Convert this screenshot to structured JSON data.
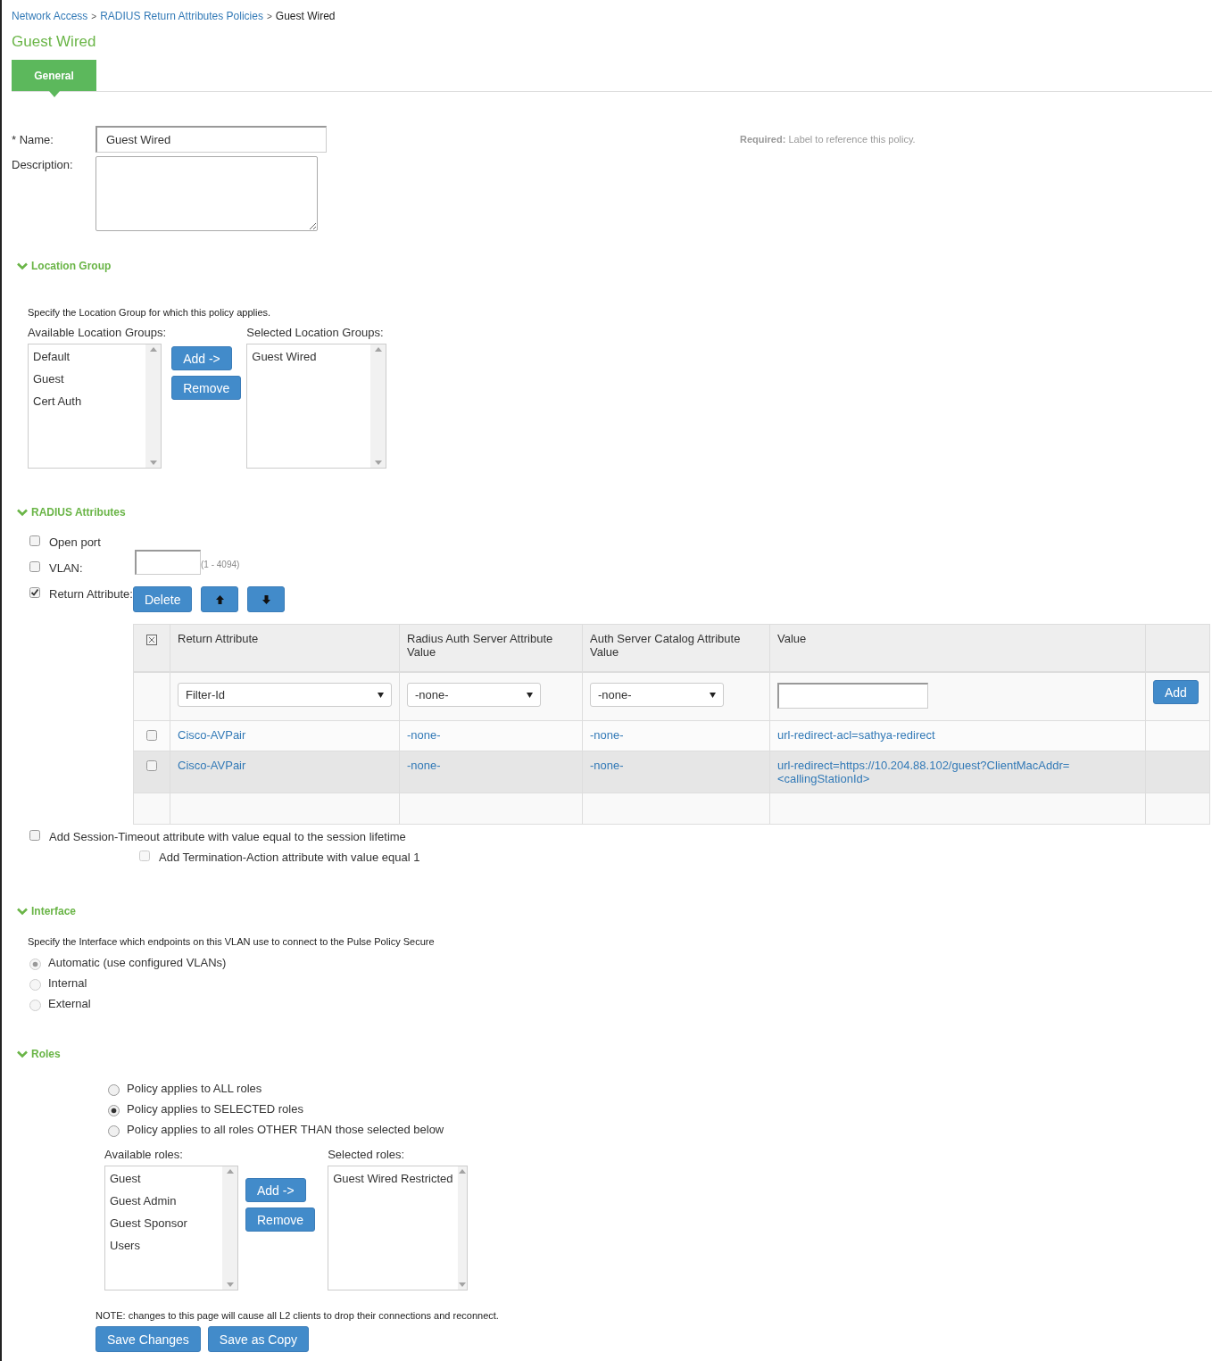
{
  "breadcrumb": [
    {
      "label": "Network Access",
      "kind": "link"
    },
    {
      "label": "RADIUS Return Attributes Policies",
      "kind": "link"
    },
    {
      "label": "Guest Wired",
      "kind": "current"
    }
  ],
  "separator": ">",
  "title": "Guest Wired",
  "tabs": [
    {
      "label": "General",
      "selected": true
    }
  ],
  "name_field": {
    "label": "* Name:",
    "value": "Guest Wired",
    "hint": "**Required:** Label to reference this policy."
  },
  "description_field": {
    "label": "Description:"
  },
  "location_group": {
    "title": "Location Group",
    "expanded": true,
    "intro": "Specify the Location Group for which this policy applies.",
    "available": {
      "label": "Available Location Groups:",
      "items": [
        "Default",
        "Guest",
        "Cert Auth"
      ]
    },
    "selected": {
      "label": "Selected Location Groups:",
      "items": [
        "Guest Wired"
      ]
    },
    "buttons": [
      "Add ->",
      "Remove"
    ]
  },
  "radius_attributes": {
    "title": "RADIUS Attributes",
    "expanded": true,
    "options": [
      {
        "kind": "plain",
        "label": "Open port",
        "checked": false
      },
      {
        "kind": "field",
        "label": "VLAN:",
        "checked": false,
        "range": "(1 - 4094)"
      },
      {
        "kind": "toolbar",
        "label": "Return Attribute:",
        "checked": true
      }
    ],
    "toolbar": [
      {
        "kind": "text",
        "label": "Delete"
      },
      {
        "kind": "up"
      },
      {
        "kind": "down"
      }
    ],
    "table": {
      "columns": [
        "Return Attribute",
        "Radius Auth Server Attribute Value",
        "Auth Server Catalog Attribute Value",
        "Value"
      ],
      "entry": {
        "return_attribute": "Filter-Id",
        "radius_value": "-none-",
        "catalog_value": "-none-",
        "add": "Add"
      },
      "rows": [
        {
          "checked": false,
          "highlighted": false,
          "cells": [
            "Cisco-AVPair",
            "-none-",
            "-none-",
            "url-redirect-acl=sathya-redirect"
          ]
        },
        {
          "checked": false,
          "highlighted": true,
          "cells": [
            "Cisco-AVPair",
            "-none-",
            "-none-",
            "url-redirect=https://10.204.88.102/guest?ClientMacAddr=<callingStationId>"
          ]
        }
      ]
    },
    "session_timeout": {
      "label": "Add Session-Timeout attribute with value equal to the session lifetime",
      "checked": false
    },
    "termination_action": {
      "label": "Add Termination-Action attribute with value equal 1",
      "checked": false,
      "disabled": true
    }
  },
  "interface": {
    "title": "Interface",
    "expanded": true,
    "intro": "Specify the Interface which endpoints on this VLAN use to connect to the Pulse Policy Secure",
    "options": [
      {
        "label": "Automatic (use configured VLANs)",
        "selected": true,
        "disabled": true
      },
      {
        "label": "Internal",
        "selected": false,
        "disabled": true
      },
      {
        "label": "External",
        "selected": false,
        "disabled": true
      }
    ]
  },
  "roles": {
    "title": "Roles",
    "expanded": true,
    "options": [
      {
        "label": "Policy applies to ALL roles",
        "selected": false
      },
      {
        "label": "Policy applies to SELECTED roles",
        "selected": true
      },
      {
        "label": "Policy applies to all roles OTHER THAN those selected below",
        "selected": false
      }
    ],
    "available": {
      "label": "Available roles:",
      "items": [
        "Guest",
        "Guest Admin",
        "Guest Sponsor",
        "Users"
      ]
    },
    "selected": {
      "label": "Selected roles:",
      "items": [
        "Guest Wired Restricted"
      ]
    },
    "buttons": [
      "Add ->",
      "Remove"
    ]
  },
  "note": "NOTE: changes to this page will cause all L2 clients to drop their connections and reconnect.",
  "footer_buttons": [
    "Save Changes",
    "Save as Copy"
  ]
}
